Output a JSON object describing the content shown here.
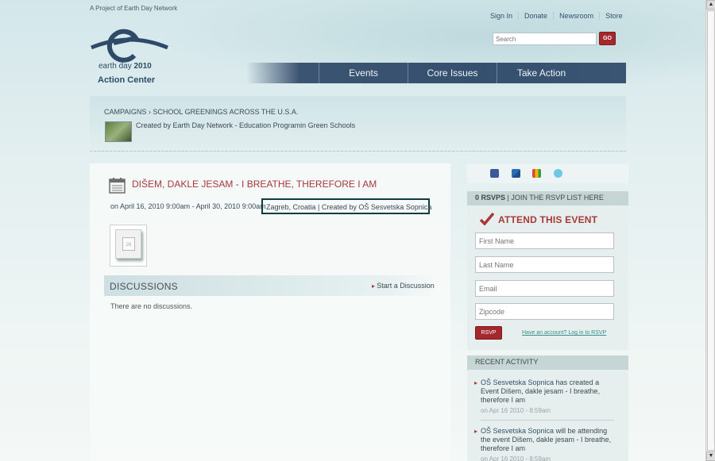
{
  "header": {
    "tagline": "A Project of Earth Day Network",
    "top_links": [
      "Sign In",
      "Donate",
      "Newsroom",
      "Store"
    ],
    "search_placeholder": "Search",
    "go_label": "GO",
    "logo_line1_a": "earth day",
    "logo_line1_b": "2010",
    "logo_line2": "Action Center"
  },
  "nav": {
    "items": [
      "Events",
      "Core Issues",
      "Take Action"
    ]
  },
  "campaign": {
    "crumb_root": "CAMPAIGNS",
    "crumb_sep": "›",
    "crumb_current": "SCHOOL GREENINGS ACROSS THE U.S.A.",
    "created_text": "Created by Earth Day Network - Education Programin Green Schools"
  },
  "event": {
    "title": "DIŠEM, DAKLE JESAM - I BREATHE, THEREFORE I AM",
    "date_text": "on April 16, 2010 9:00am - April 30, 2010 9:00am",
    "location_text": "Zagreb, Croatia |  Created by OŠ Sesvetska Sopnica",
    "calendar_day": "26"
  },
  "discussions": {
    "title": "DISCUSSIONS",
    "start_link": "Start a Discussion",
    "empty_text": "There are no discussions."
  },
  "social": {
    "icons": [
      "facebook-icon",
      "windows-icon",
      "google-icon",
      "twitter-icon"
    ]
  },
  "rsvp": {
    "count_label": "0 RSVPS",
    "join_text": " | JOIN THE RSVP LIST HERE",
    "attend_title": "ATTEND THIS EVENT",
    "first_name_placeholder": "First Name",
    "last_name_placeholder": "Last Name",
    "email_placeholder": "Email",
    "zipcode_placeholder": "Zipcode",
    "button_label": "RSVP",
    "login_link": "Have an account? Log in to RSVP"
  },
  "recent": {
    "header": "RECENT ACTIVITY",
    "items": [
      {
        "who": "OŠ Sesvetska Sopnica",
        "text": " has created a Event Dišem, dakle jesam - I breathe, therefore I am",
        "time": "on Apr 16 2010 - 8:59am"
      },
      {
        "who": "OŠ Sesvetska Sopnica",
        "text": " will be attending the event Dišem, dakle jesam - I breathe, therefore I am",
        "time": "on Apr 16 2010 - 8:59am"
      }
    ]
  },
  "colors": {
    "accent_red": "#a8383a",
    "nav_blue": "#35506e",
    "panel": "#e6efed"
  }
}
